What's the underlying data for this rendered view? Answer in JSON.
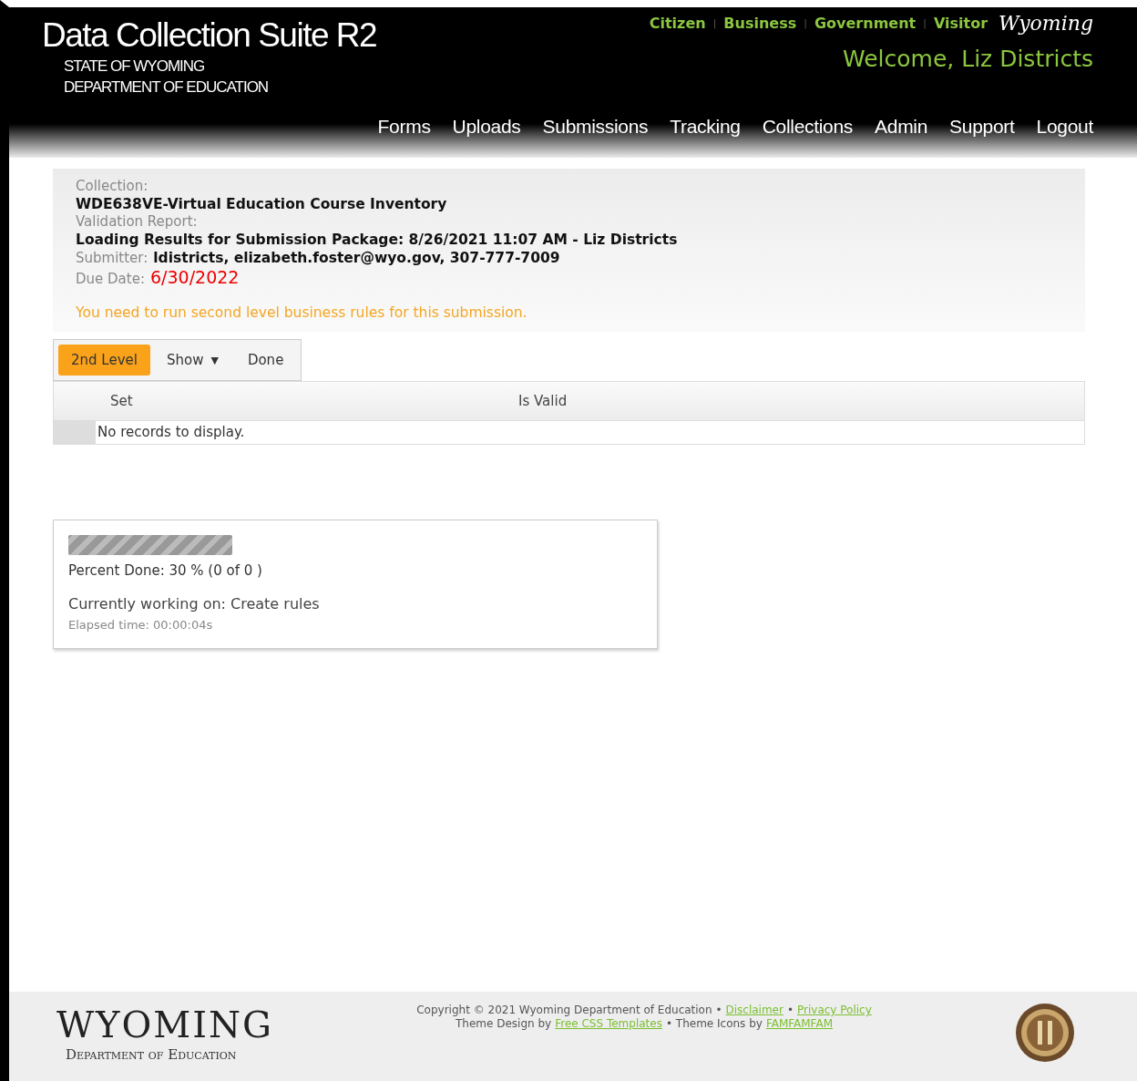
{
  "header": {
    "title": "Data Collection Suite R2",
    "subtitle_lines": [
      "STATE OF WYOMING",
      "DEPARTMENT OF EDUCATION"
    ],
    "audience_links": [
      "Citizen",
      "Business",
      "Government",
      "Visitor"
    ],
    "audience_separator": "|",
    "logo_text": "Wyoming",
    "welcome": "Welcome, Liz Districts",
    "nav": [
      "Forms",
      "Uploads",
      "Submissions",
      "Tracking",
      "Collections",
      "Admin",
      "Support",
      "Logout"
    ]
  },
  "summary": {
    "collection_label": "Collection:",
    "collection": "WDE638VE-Virtual Education Course Inventory",
    "report_label": "Validation Report:",
    "report": "Loading Results for Submission Package: 8/26/2021 11:07 AM - Liz Districts",
    "submitter_label": "Submitter:",
    "submitter": "ldistricts, elizabeth.foster@wyo.gov, 307-777-7009",
    "due_label": "Due Date:",
    "due": "6/30/2022",
    "warning": "You need to run second level business rules for this submission."
  },
  "toolbar": [
    {
      "kind": "primary",
      "label": "2nd Level"
    },
    {
      "kind": "dropdown",
      "label": "Show",
      "caret": "▼"
    },
    {
      "kind": "plain",
      "label": "Done"
    }
  ],
  "table": {
    "columns": [
      "Set",
      "Is Valid"
    ],
    "empty_text": "No records to display."
  },
  "progress": {
    "level": 1,
    "percent_text": "Percent Done: 30 % (0 of 0 )",
    "working_text": "Currently working on: Create rules",
    "elapsed_text": "Elapsed time: 00:00:04s"
  },
  "footer": {
    "logo_title": "WYOMING",
    "logo_subtitle": "Department of Education",
    "lines": [
      [
        {
          "kind": "text",
          "text": "Copyright © 2021 Wyoming Department of Education •"
        },
        {
          "kind": "link",
          "text": "Disclaimer"
        },
        {
          "kind": "text",
          "text": "•"
        },
        {
          "kind": "link",
          "text": "Privacy Policy"
        }
      ],
      [
        {
          "kind": "text",
          "text": "Theme Design by"
        },
        {
          "kind": "link",
          "text": "Free CSS Templates"
        },
        {
          "kind": "text",
          "text": "•  Theme Icons by"
        },
        {
          "kind": "link",
          "text": "FAMFAMFAM"
        }
      ]
    ]
  }
}
